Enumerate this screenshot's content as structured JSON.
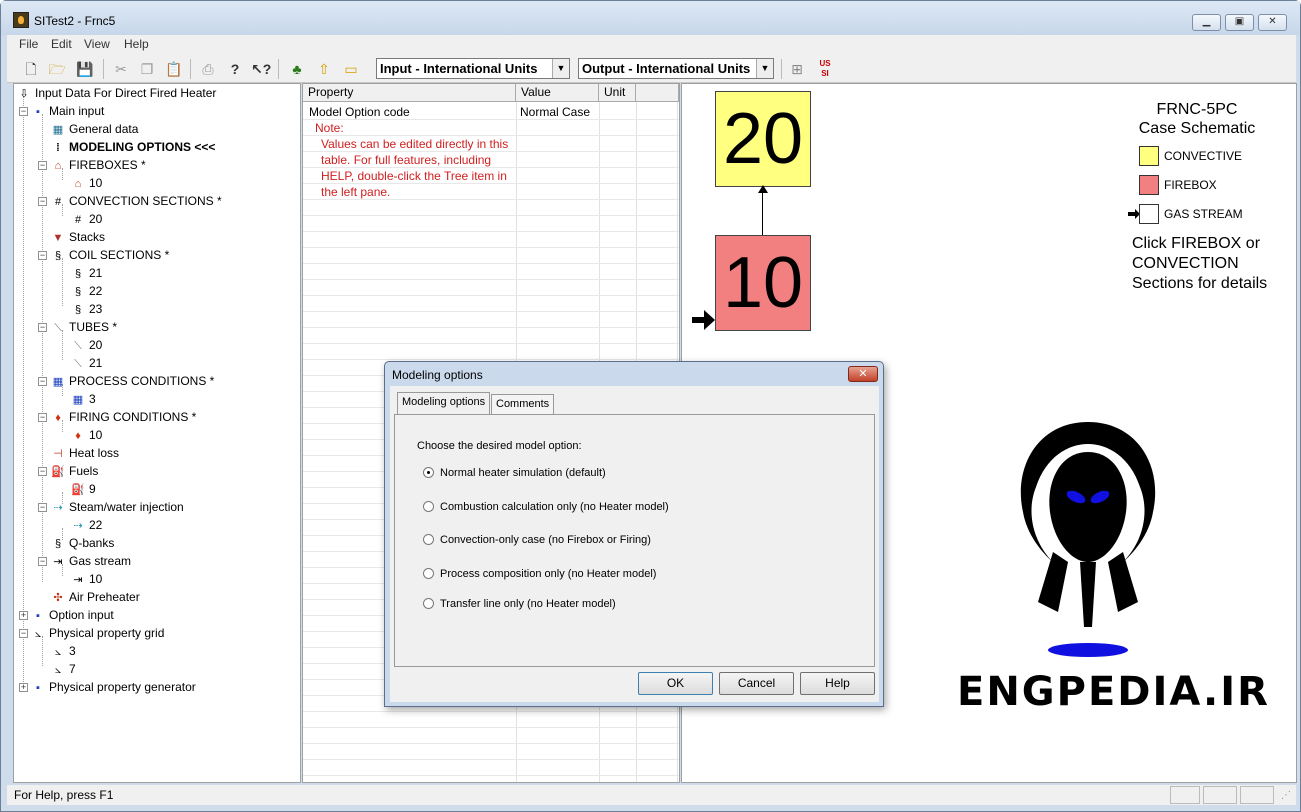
{
  "window": {
    "title": "SITest2 - Frnc5"
  },
  "menu": [
    "File",
    "Edit",
    "View",
    "Help"
  ],
  "toolbar": {
    "input_units": "Input - International Units",
    "output_units": "Output - International Units",
    "icons": [
      "new-icon",
      "open-icon",
      "save-icon",
      "cut-icon",
      "copy-icon",
      "paste-icon",
      "print-icon",
      "help-icon",
      "context-help-icon",
      "tree-icon",
      "up-arrow-icon",
      "folder-icon",
      "tree-view-icon",
      "us-si-units-icon"
    ]
  },
  "tree": {
    "root": "Input Data For Direct Fired Heater",
    "main_input": "Main input",
    "general_data": "General data",
    "modeling_options": "MODELING OPTIONS <<<",
    "fireboxes": "FIREBOXES *",
    "firebox_10": "10",
    "convection_sections": "CONVECTION SECTIONS *",
    "convection_20": "20",
    "stacks": "Stacks",
    "coil_sections": "COIL SECTIONS *",
    "coil_21": "21",
    "coil_22": "22",
    "coil_23": "23",
    "tubes": "TUBES *",
    "tube_20": "20",
    "tube_21": "21",
    "process_conditions": "PROCESS CONDITIONS *",
    "process_3": "3",
    "firing_conditions": "FIRING CONDITIONS *",
    "firing_10": "10",
    "heat_loss": "Heat loss",
    "fuels": "Fuels",
    "fuel_9": "9",
    "steam_water": "Steam/water injection",
    "steam_22": "22",
    "q_banks": "Q-banks",
    "gas_stream": "Gas stream",
    "gas_10": "10",
    "air_preheater": "Air Preheater",
    "option_input": "Option input",
    "phys_grid": "Physical property grid",
    "grid_3": "3",
    "grid_7": "7",
    "phys_generator": "Physical property generator"
  },
  "grid": {
    "headers": [
      "Property",
      "Value",
      "Unit"
    ],
    "row_property": "Model Option code",
    "row_value": "Normal Case",
    "note_label": "Note:",
    "note_lines": [
      "Values can be edited directly in this",
      "table.  For full features, including",
      "HELP, double-click the Tree item in",
      "the left pane."
    ]
  },
  "schematic": {
    "title1": "FRNC-5PC",
    "title2": "Case Schematic",
    "conv_number": "20",
    "firebox_number": "10",
    "legend": {
      "convective": "CONVECTIVE",
      "firebox": "FIREBOX",
      "gas_stream": "GAS STREAM"
    },
    "colors": {
      "convective": "#ffff80",
      "firebox": "#f28080"
    },
    "instructions": [
      "Click FIREBOX or",
      "CONVECTION",
      "Sections for details"
    ],
    "watermark": "ENGPEDIA.IR"
  },
  "dialog": {
    "title": "Modeling options",
    "tabs": [
      "Modeling options",
      "Comments"
    ],
    "prompt": "Choose the desired model option:",
    "options": [
      "Normal heater simulation (default)",
      "Combustion calculation only (no Heater model)",
      "Convection-only case (no Firebox or Firing)",
      "Process composition only (no Heater model)",
      "Transfer line only (no Heater model)"
    ],
    "selected_index": 0,
    "ok": "OK",
    "cancel": "Cancel",
    "help": "Help",
    "close": "✕"
  },
  "status": {
    "text": "For Help, press F1"
  }
}
